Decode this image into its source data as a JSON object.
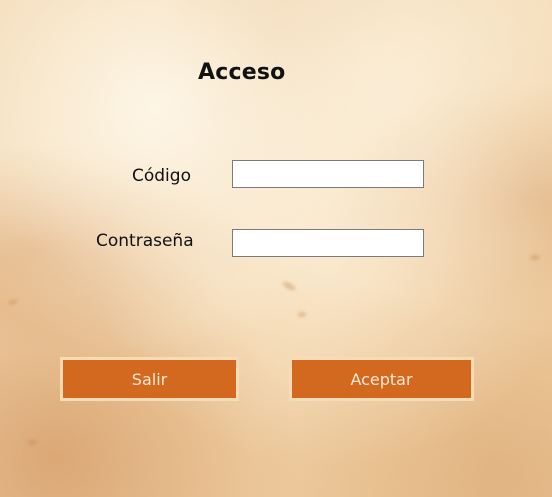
{
  "form": {
    "title": "Acceso",
    "code_label": "Código",
    "code_value": "",
    "password_label": "Contraseña",
    "password_value": ""
  },
  "actions": {
    "exit_label": "Salir",
    "accept_label": "Aceptar"
  },
  "colors": {
    "button_bg": "#d2691e",
    "button_border": "#f6dcb6",
    "background": "#f3d9b3"
  }
}
